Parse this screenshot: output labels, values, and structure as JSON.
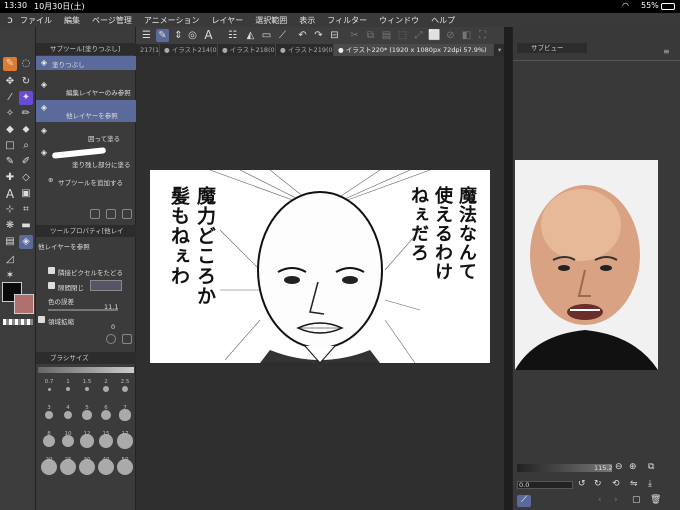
{
  "status": {
    "time": "13:30",
    "date": "10月30日(土)",
    "battery": "55%"
  },
  "menu": [
    "ファイル",
    "編集",
    "ページ管理",
    "アニメーション",
    "レイヤー",
    "選択範囲",
    "表示",
    "フィルター",
    "ウィンドウ",
    "ヘルプ"
  ],
  "subtool": {
    "header": "サブツール[塗りつぶし]",
    "group_label": "塗りつぶし",
    "items": [
      "編集レイヤーのみ参照",
      "他レイヤーを参照",
      "囲って塗る",
      "塗り残し部分に塗る"
    ],
    "add_label": "サブツールを追加する"
  },
  "toolprop": {
    "header": "ツールプロパティ[他レイ",
    "name": "他レイヤーを参照",
    "adjacent": "隣接ピクセルをたどる",
    "close_gap": "隙間閉じ",
    "color_margin": "色の誤差",
    "color_margin_value": "11.1",
    "area_scaling": "領域拡縮",
    "area_scaling_value": "0"
  },
  "brushsize": {
    "header": "ブラシサイズ",
    "values": [
      "0.7",
      "1",
      "1.5",
      "2",
      "2.5",
      "3",
      "4",
      "5",
      "6",
      "7",
      "8",
      "10",
      "12",
      "15",
      "17",
      "20",
      "25",
      "30",
      "40",
      "50"
    ]
  },
  "tabs": [
    "217(1)",
    "イラスト214(0)",
    "イラスト218(0)",
    "イラスト219(0)",
    "イラスト220* (1920 x 1080px 72dpi 57.9%)"
  ],
  "manga_text": {
    "right": "魔法なんて\n使えるわけ\nねぇだろ",
    "left": "魔力どころか\n髪もねぇわ"
  },
  "subview": {
    "header": "サブビュー",
    "zoom": "115.2",
    "angle": "0.0"
  },
  "colors": {
    "accent": "#6a4bd6",
    "selected": "#5a6a9a"
  }
}
